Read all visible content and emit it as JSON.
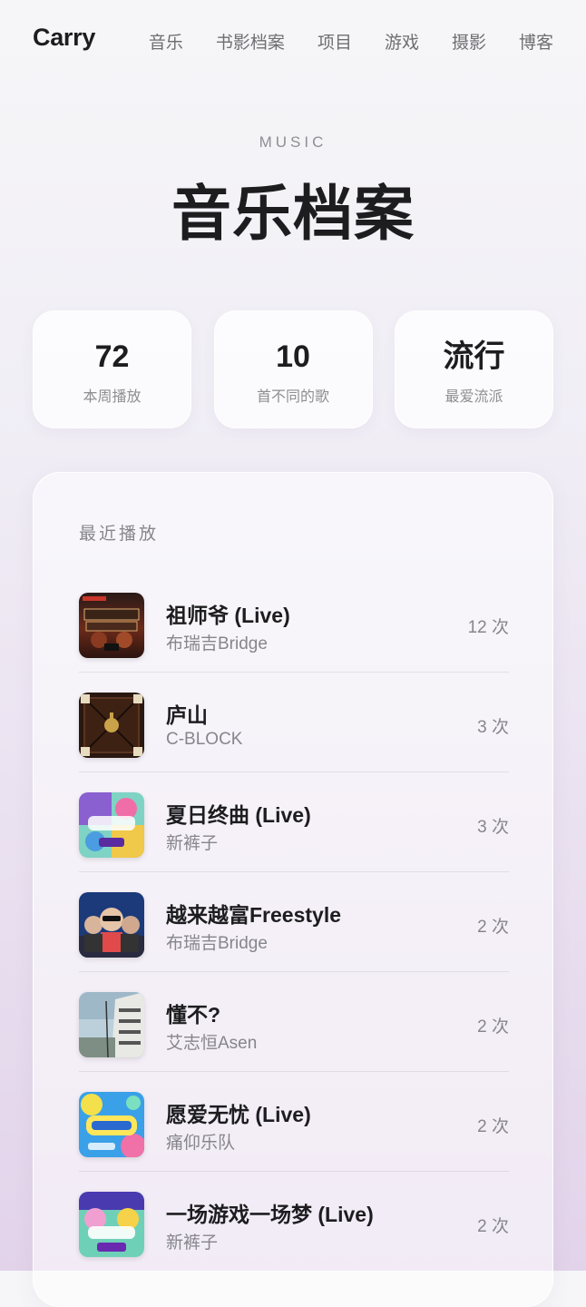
{
  "nav": {
    "brand": "Carry",
    "links": [
      "音乐",
      "书影档案",
      "项目",
      "游戏",
      "摄影",
      "博客"
    ]
  },
  "header": {
    "eyebrow": "MUSIC",
    "title": "音乐档案"
  },
  "stats": [
    {
      "value": "72",
      "label": "本周播放"
    },
    {
      "value": "10",
      "label": "首不同的歌"
    },
    {
      "value": "流行",
      "label": "最爱流派"
    }
  ],
  "recent": {
    "title": "最近播放",
    "tracks": [
      {
        "name": "祖师爷 (Live)",
        "artist": "布瑞吉Bridge",
        "plays": "12 次",
        "cover": "cover-stage-show"
      },
      {
        "name": "庐山",
        "artist": "C-BLOCK",
        "plays": "3 次",
        "cover": "cover-dark-wood"
      },
      {
        "name": "夏日终曲 (Live)",
        "artist": "新裤子",
        "plays": "3 次",
        "cover": "cover-summer-band-11"
      },
      {
        "name": "越来越富Freestyle",
        "artist": "布瑞吉Bridge",
        "plays": "2 次",
        "cover": "cover-cartoon-trio"
      },
      {
        "name": "懂不?",
        "artist": "艾志恒Asen",
        "plays": "2 次",
        "cover": "cover-building-sky"
      },
      {
        "name": "愿爱无忧 (Live)",
        "artist": "痛仰乐队",
        "plays": "2 次",
        "cover": "cover-summer-band-blue"
      },
      {
        "name": "一场游戏一场梦 (Live)",
        "artist": "新裤子",
        "plays": "2 次",
        "cover": "cover-summer-band-10"
      }
    ]
  },
  "colors": {
    "text_primary": "#1d1d1f",
    "text_secondary": "#86868b",
    "card_bg": "#ffffffb8",
    "bg_top": "#f6f6f8",
    "bg_bottom": "#e2d3ea"
  }
}
